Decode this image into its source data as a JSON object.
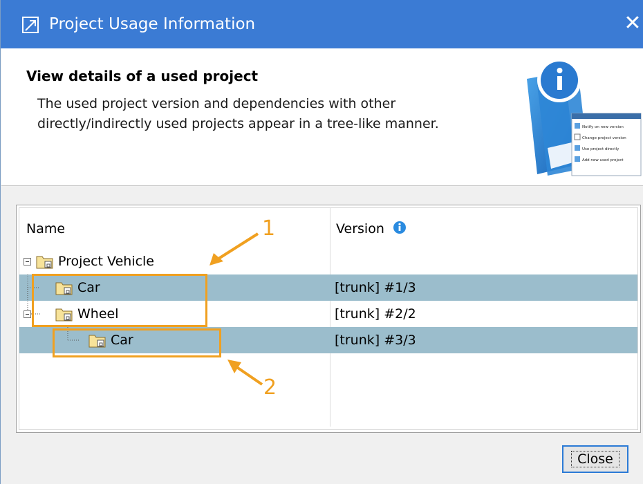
{
  "window": {
    "title": "Project Usage Information",
    "close_glyph": "✕"
  },
  "header": {
    "title": "View details of a used project",
    "description_lines": [
      "The used project version and dependencies with other",
      "directly/indirectly used projects appear in a tree-like manner."
    ],
    "illustration_checklist": [
      "Notify on new version",
      "Change project version",
      "Use project directly",
      "Add new used project"
    ]
  },
  "table": {
    "columns": [
      "Name",
      "Version"
    ],
    "version_info_icon": "info-icon",
    "rows": [
      {
        "name": "Project Vehicle",
        "version": "",
        "level": 0,
        "selected": false
      },
      {
        "name": "Car",
        "version": "[trunk] #1/3",
        "level": 1,
        "selected": true
      },
      {
        "name": "Wheel",
        "version": "[trunk] #2/2",
        "level": 1,
        "selected": false
      },
      {
        "name": "Car",
        "version": "[trunk] #3/3",
        "level": 2,
        "selected": true
      }
    ]
  },
  "annotations": {
    "callout_1": "1",
    "callout_2": "2",
    "color": "#f0a020"
  },
  "buttons": {
    "close_label": "Close"
  },
  "colors": {
    "titlebar": "#3b7bd4",
    "selected_row": "#9bbdcc"
  }
}
